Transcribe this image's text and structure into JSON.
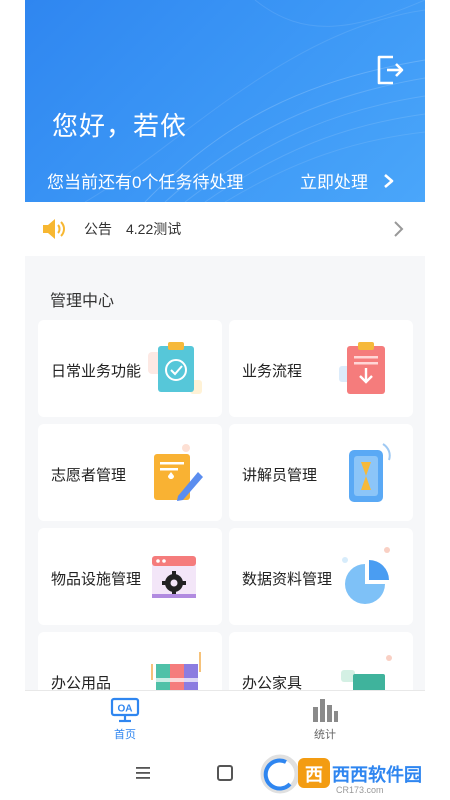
{
  "header": {
    "greeting": "您好，若依",
    "task_text": "您当前还有0个任务待处理",
    "task_action": "立即处理"
  },
  "notice": {
    "tag": "公告",
    "text": "4.22测试"
  },
  "panel": {
    "title": "管理中心",
    "cards": [
      {
        "label": "日常业务功能",
        "icon": "clipboard-check-icon"
      },
      {
        "label": "业务流程",
        "icon": "clipboard-download-icon"
      },
      {
        "label": "志愿者管理",
        "icon": "document-edit-icon"
      },
      {
        "label": "讲解员管理",
        "icon": "hourglass-phone-icon"
      },
      {
        "label": "物品设施管理",
        "icon": "gear-window-icon"
      },
      {
        "label": "数据资料管理",
        "icon": "pie-chart-icon"
      },
      {
        "label": "办公用品",
        "icon": "binders-icon"
      },
      {
        "label": "办公家具",
        "icon": "desk-icon"
      }
    ]
  },
  "tabbar": {
    "home": "首页",
    "stats": "统计"
  },
  "watermark": {
    "brand": "西西软件园",
    "domain": "CR173.com"
  },
  "colors": {
    "primary": "#2f86f0",
    "notice_icon": "#f7b731"
  }
}
